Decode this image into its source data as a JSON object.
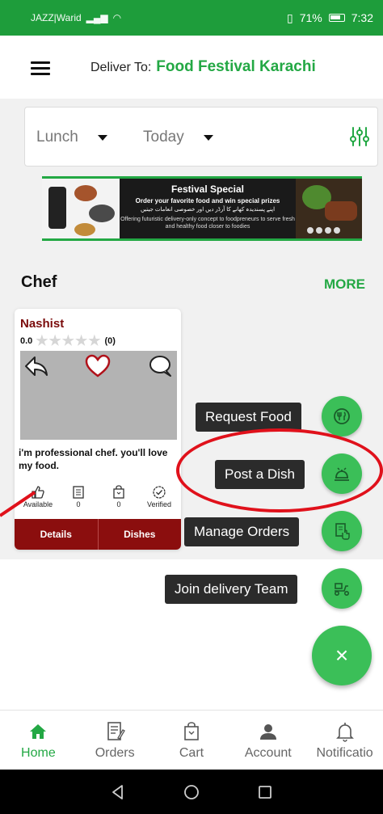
{
  "status": {
    "carrier": "JAZZ|Warid",
    "battery": "71%",
    "time": "7:32"
  },
  "header": {
    "deliver_label": "Deliver To:",
    "location": "Food Festival Karachi"
  },
  "filters": {
    "meal": "Lunch",
    "day": "Today"
  },
  "banner": {
    "title": "Festival Special",
    "subtitle": "Order your favorite food and win special prizes",
    "urdu": "اپنے پسندیدہ کھانے کا آرڈر دیں اور خصوصی انعامات جیتیں",
    "description": "Offering futuristic delivery-only concept to foodpreneurs to serve fresh and healthy food closer to foodies"
  },
  "section": {
    "title": "Chef",
    "more": "MORE"
  },
  "chef": {
    "name": "Nashist",
    "rating": "0.0",
    "stars": "★★★★★",
    "reviews": "(0)",
    "bio": "i'm professional chef. you'll love my food.",
    "stats": [
      {
        "label": "Available",
        "icon": "thumbs-up-icon"
      },
      {
        "label": "0",
        "icon": "menu-list-icon"
      },
      {
        "label": "0",
        "icon": "bag-icon"
      },
      {
        "label": "Verified",
        "icon": "check-circle-icon"
      }
    ],
    "buttons": {
      "details": "Details",
      "dishes": "Dishes"
    }
  },
  "fab_menu": {
    "items": [
      {
        "label": "Request Food",
        "icon": "food-request-icon"
      },
      {
        "label": "Post a Dish",
        "icon": "chef-dish-icon"
      },
      {
        "label": "Manage Orders",
        "icon": "orders-hand-icon"
      },
      {
        "label": "Join delivery Team",
        "icon": "delivery-scooter-icon"
      }
    ],
    "close_glyph": "×"
  },
  "bottom_nav": {
    "items": [
      {
        "label": "Home",
        "icon": "home-icon",
        "active": true
      },
      {
        "label": "Orders",
        "icon": "orders-icon"
      },
      {
        "label": "Cart",
        "icon": "cart-icon"
      },
      {
        "label": "Account",
        "icon": "account-icon"
      },
      {
        "label": "Notificatio",
        "icon": "bell-icon"
      }
    ]
  },
  "colors": {
    "brand_green": "#23a844",
    "status_green": "#1e9d3b",
    "fab_green": "#3bbf58",
    "chef_red": "#8b0e0e",
    "highlight_red": "#e0111b"
  }
}
